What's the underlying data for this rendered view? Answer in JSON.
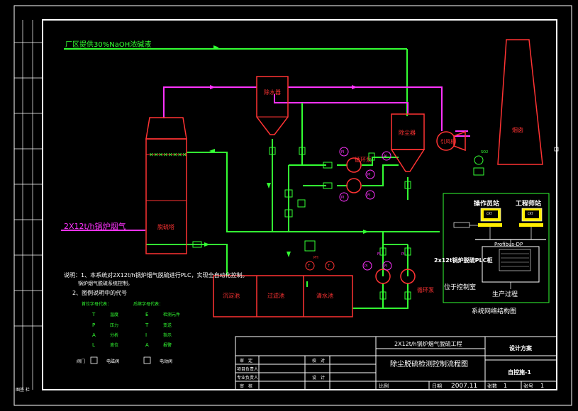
{
  "header": {
    "naoh_line": "厂区提供30%NaOH浓碱液",
    "boiler_input": "2X12t/h锅炉烟气"
  },
  "equipment": {
    "dust_hopper": "除水器",
    "cyclone": "除尘器",
    "fan": "引风机",
    "chimney": "烟囱",
    "tower": "脱硫塔",
    "pump_top": "循环泵",
    "pump_bottom": "循环泵",
    "tank_1": "沉淀池",
    "tank_2": "过滤池",
    "tank_3": "清水池"
  },
  "instruments": {
    "fi1": "FI",
    "ai1": "AI",
    "pi1": "PI",
    "pi2": "PI",
    "fi2": "FI",
    "so2": "SO2",
    "t1": "T",
    "t2": "T",
    "ph": "PH",
    "pi3": "PI",
    "fi3": "FI",
    "pi4": "PI",
    "fi4": "FI"
  },
  "notes": {
    "line1": "说明：1、本系统对2X12t/h锅炉烟气脱硫进行PLC，实现全自动化控制。",
    "line2": "锅炉烟气脱硫系统控制。",
    "line3": "2、图例说明中的代号",
    "col1_title": "首位字母代表：",
    "col2_title": "后继字母代表：",
    "rows": [
      {
        "a": "T",
        "b": "温度",
        "c": "E",
        "d": "检测元件"
      },
      {
        "a": "P",
        "b": "压力",
        "c": "T",
        "d": "变送"
      },
      {
        "a": "A",
        "b": "分析",
        "c": "I",
        "d": "指示"
      },
      {
        "a": "L",
        "b": "液位",
        "c": "A",
        "d": "报警"
      }
    ],
    "legend_a": "阀门",
    "legend_b": "电磁阀",
    "legend_c": "电动阀"
  },
  "network": {
    "operator": "操作员站",
    "engineer": "工程师站",
    "bus": "Profibus-DP",
    "plc": "2x12t锅炉脱硫PLC柜",
    "control_room": "位于控制室",
    "process": "生产过程",
    "caption": "系统网络结构图",
    "crt": "CRT"
  },
  "title_block": {
    "project": "2X12t/h锅炉烟气脱硫工程",
    "drawing": "除尘脱硫检测控制流程图",
    "design_stage": "设计方案",
    "drawing_no": "自控施-1",
    "date_label": "日期",
    "date": "2007.11",
    "scale_label": "比例",
    "sheet_label": "张数",
    "sheet": "1",
    "page_label": "张号",
    "page": "1",
    "r1": "审　定",
    "r2": "项目负责人",
    "r3": "专业负责人",
    "r4": "审　核",
    "c1": "校　对",
    "c2": "设　计"
  },
  "left_strip": {
    "label": "图签 栏"
  }
}
